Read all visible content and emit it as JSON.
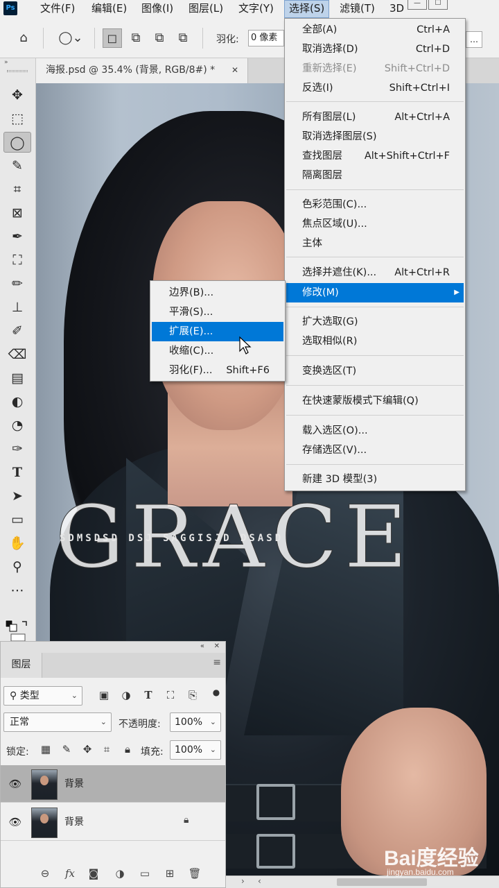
{
  "app": {
    "logo": "Ps"
  },
  "menubar": {
    "items": [
      "文件(F)",
      "编辑(E)",
      "图像(I)",
      "图层(L)",
      "文字(Y)",
      "选择(S)",
      "滤镜(T)",
      "3D"
    ],
    "active": "选择(S)"
  },
  "window_controls": {
    "minimize": "—",
    "maximize": "☐"
  },
  "options_bar": {
    "home_icon": "home-icon",
    "tool_icon": "lasso-icon",
    "feather_label": "羽化:",
    "feather_value": "0 像素"
  },
  "document": {
    "tab_title": "海报.psd @ 35.4% (背景, RGB/8#) *",
    "close": "✕"
  },
  "canvas": {
    "title_text": "GRACE",
    "sub_text": "SDMSDSD DSJ SAGGISJD DSASD"
  },
  "select_menu": {
    "items": [
      {
        "label": "全部(A)",
        "shortcut": "Ctrl+A"
      },
      {
        "label": "取消选择(D)",
        "shortcut": "Ctrl+D"
      },
      {
        "label": "重新选择(E)",
        "shortcut": "Shift+Ctrl+D",
        "disabled": true
      },
      {
        "label": "反选(I)",
        "shortcut": "Shift+Ctrl+I"
      },
      {
        "label": "所有图层(L)",
        "shortcut": "Alt+Ctrl+A"
      },
      {
        "label": "取消选择图层(S)",
        "shortcut": ""
      },
      {
        "label": "查找图层",
        "shortcut": "Alt+Shift+Ctrl+F"
      },
      {
        "label": "隔离图层",
        "shortcut": ""
      },
      {
        "label": "色彩范围(C)...",
        "shortcut": ""
      },
      {
        "label": "焦点区域(U)...",
        "shortcut": ""
      },
      {
        "label": "主体",
        "shortcut": ""
      },
      {
        "label": "选择并遮住(K)...",
        "shortcut": "Alt+Ctrl+R"
      },
      {
        "label": "修改(M)",
        "shortcut": "",
        "submenu": true,
        "highlight": true
      },
      {
        "label": "扩大选取(G)",
        "shortcut": ""
      },
      {
        "label": "选取相似(R)",
        "shortcut": ""
      },
      {
        "label": "变换选区(T)",
        "shortcut": ""
      },
      {
        "label": "在快速蒙版模式下编辑(Q)",
        "shortcut": ""
      },
      {
        "label": "载入选区(O)...",
        "shortcut": ""
      },
      {
        "label": "存储选区(V)...",
        "shortcut": ""
      },
      {
        "label": "新建 3D 模型(3)",
        "shortcut": ""
      }
    ]
  },
  "modify_menu": {
    "items": [
      {
        "label": "边界(B)...",
        "shortcut": ""
      },
      {
        "label": "平滑(S)...",
        "shortcut": ""
      },
      {
        "label": "扩展(E)...",
        "shortcut": "",
        "highlight": true
      },
      {
        "label": "收缩(C)...",
        "shortcut": ""
      },
      {
        "label": "羽化(F)...",
        "shortcut": "Shift+F6"
      }
    ]
  },
  "layers_panel": {
    "tab": "图层",
    "filter_type": "类型",
    "blend_mode": "正常",
    "opacity_label": "不透明度:",
    "opacity_value": "100%",
    "lock_label": "锁定:",
    "fill_label": "填充:",
    "fill_value": "100%",
    "layers": [
      {
        "name": "背景",
        "selected": true,
        "locked": false
      },
      {
        "name": "背景",
        "selected": false,
        "locked": true
      }
    ]
  },
  "watermark": {
    "brand": "Bai度经验",
    "url": "jingyan.baidu.com"
  },
  "colors": {
    "menu_highlight": "#0078d7",
    "menubar_active": "#bed3ea",
    "ui_bg": "#f0f0f0"
  }
}
